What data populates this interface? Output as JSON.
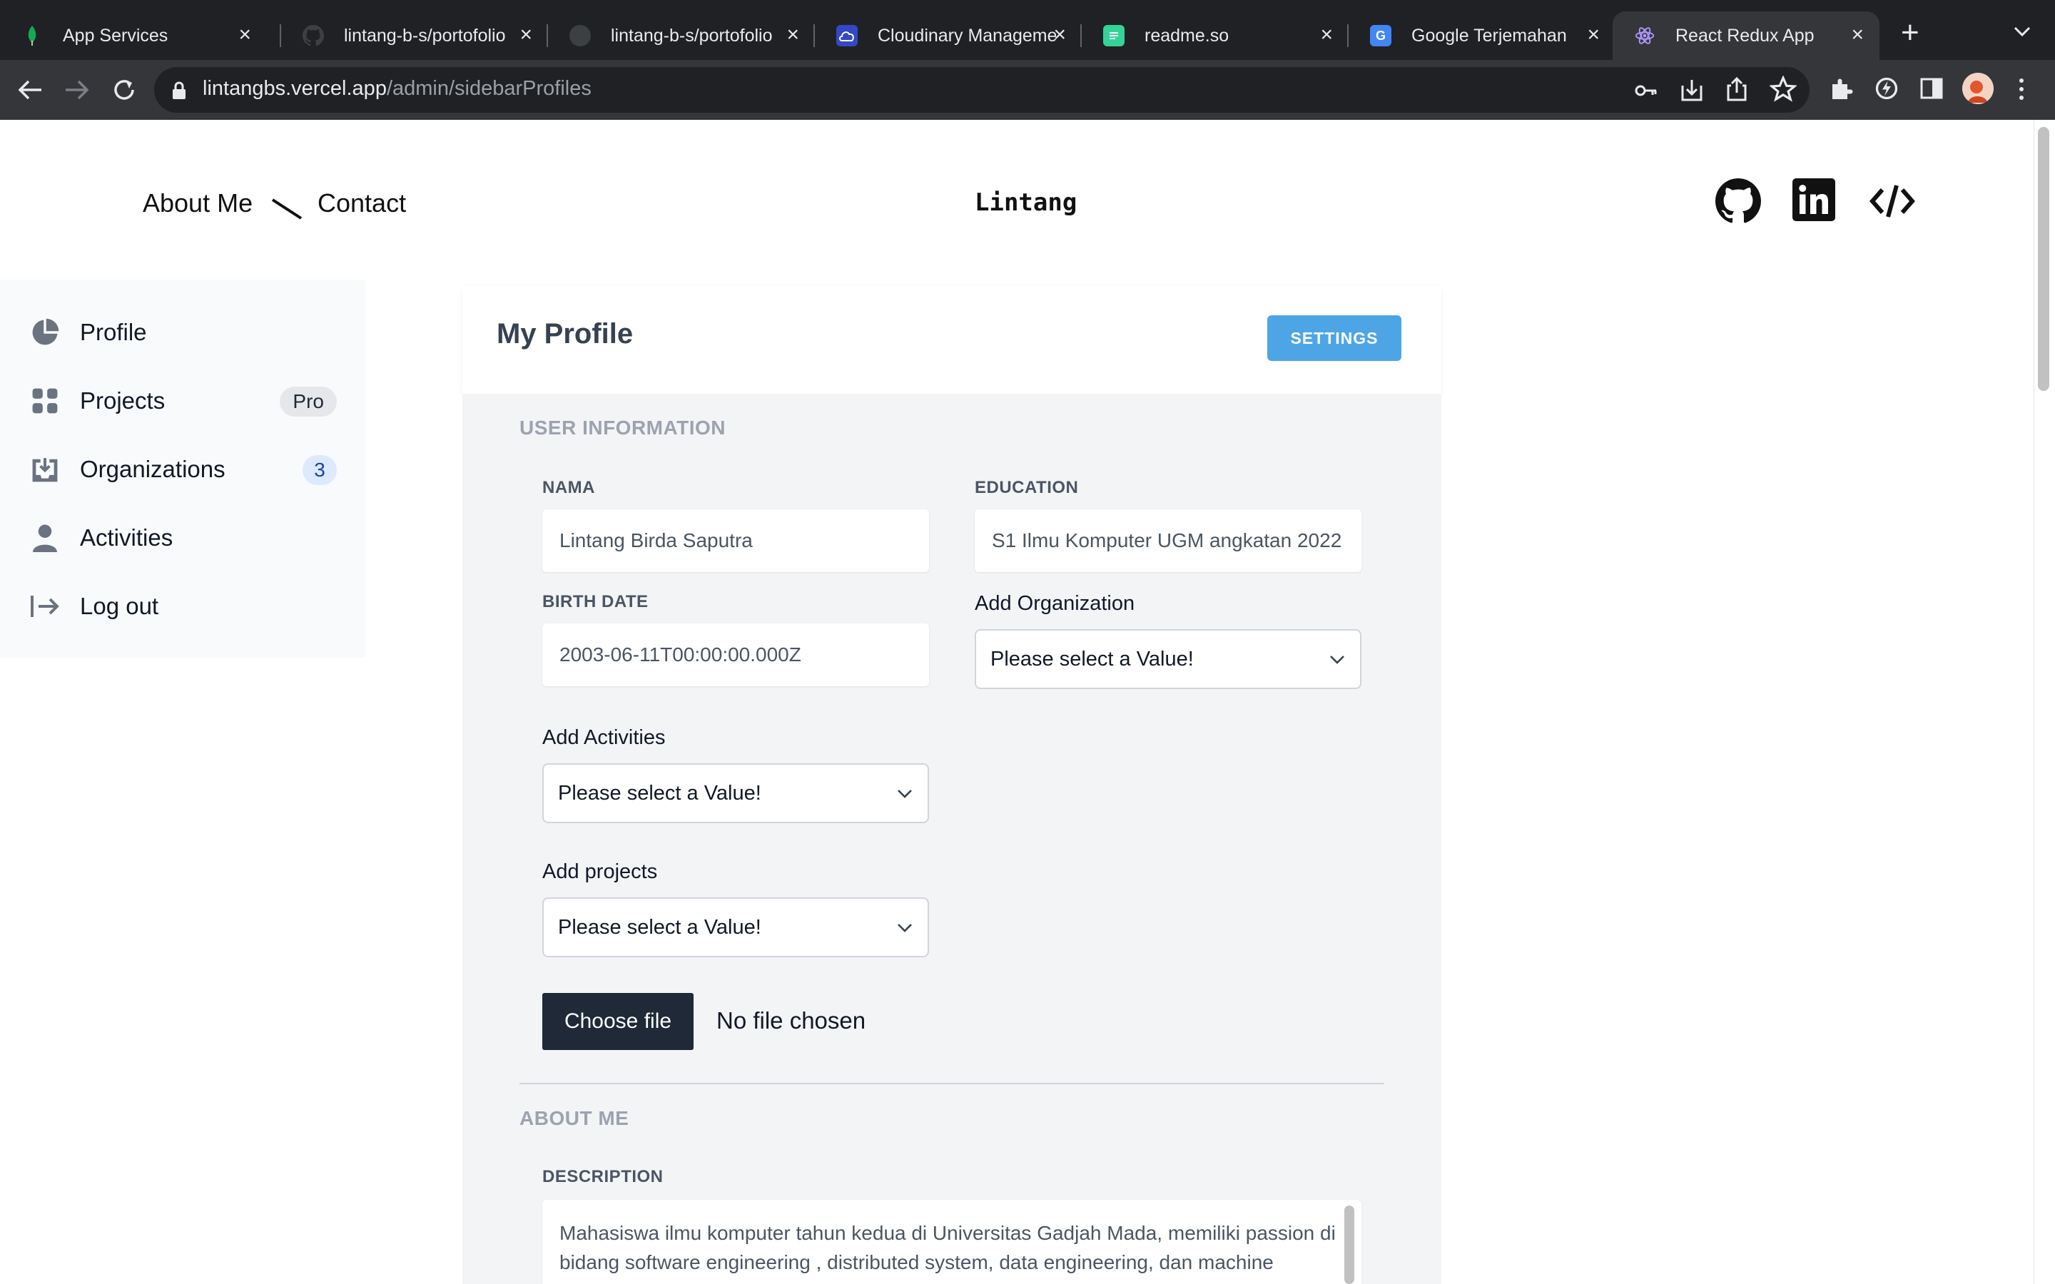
{
  "browser": {
    "tabs": [
      {
        "title": "App Services",
        "icon": "mongodb-leaf-icon",
        "active": false
      },
      {
        "title": "lintang-b-s/portofolio",
        "icon": "github-icon",
        "active": false
      },
      {
        "title": "lintang-b-s/portofolio",
        "icon": "github-icon",
        "active": false
      },
      {
        "title": "Cloudinary Management",
        "icon": "cloudinary-icon",
        "active": false
      },
      {
        "title": "readme.so",
        "icon": "readme-icon",
        "active": false
      },
      {
        "title": "Google Terjemahan",
        "icon": "google-translate-icon",
        "active": false
      },
      {
        "title": "React Redux App",
        "icon": "react-icon",
        "active": true
      }
    ],
    "url_host": "lintangbs.vercel.app",
    "url_path": "/admin/sidebarProfiles"
  },
  "header": {
    "nav": [
      "About Me",
      "Contact"
    ],
    "brand": "Lintang",
    "social_icons": [
      "github-icon",
      "linkedin-icon",
      "code-icon"
    ]
  },
  "sidebar": {
    "items": [
      {
        "label": "Profile",
        "icon": "pie-chart-icon",
        "badge": ""
      },
      {
        "label": "Projects",
        "icon": "grid-icon",
        "badge": "Pro"
      },
      {
        "label": "Organizations",
        "icon": "inbox-download-icon",
        "badge": "3"
      },
      {
        "label": "Activities",
        "icon": "user-icon",
        "badge": ""
      },
      {
        "label": "Log out",
        "icon": "logout-arrow-icon",
        "badge": ""
      }
    ]
  },
  "card": {
    "title": "My Profile",
    "settings_label": "SETTINGS",
    "user_info_heading": "USER INFORMATION",
    "nama_label": "NAMA",
    "nama_value": "Lintang Birda Saputra",
    "education_label": "EDUCATION",
    "education_value": "S1 Ilmu Komputer UGM angkatan 2022",
    "birth_label": "BIRTH DATE",
    "birth_value": "2003-06-11T00:00:00.000Z",
    "add_org_label": "Add Organization",
    "add_org_value": "Please select a Value!",
    "add_act_label": "Add Activities",
    "add_act_value": "Please select a Value!",
    "add_proj_label": "Add projects",
    "add_proj_value": "Please select a Value!",
    "choose_file_label": "Choose file",
    "no_file_label": "No file chosen",
    "about_heading": "ABOUT ME",
    "description_label": "DESCRIPTION",
    "description_value": "Mahasiswa ilmu komputer tahun kedua di Universitas Gadjah Mada, memiliki passion di bidang software engineering , distributed system, data engineering, dan machine learning. Dimulai dari"
  },
  "colors": {
    "settings_button": "#4ea5e6",
    "choose_file_button": "#1f2937",
    "chrome_dark": "#202124"
  }
}
